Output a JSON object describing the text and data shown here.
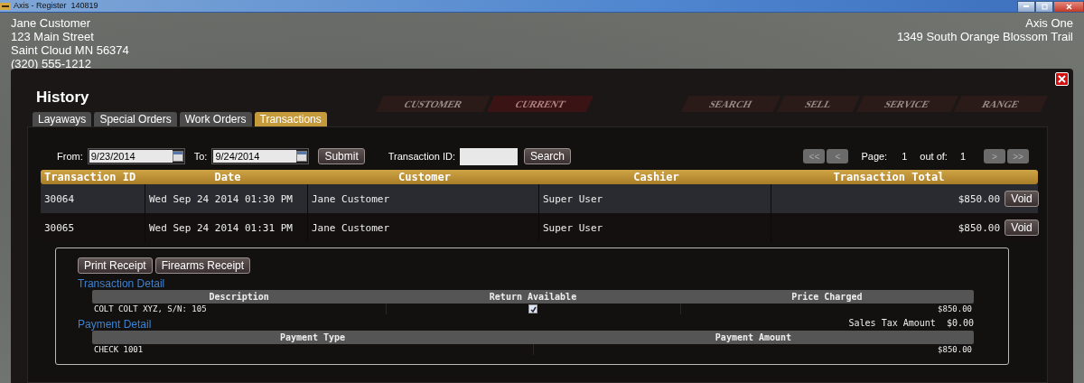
{
  "window": {
    "title": "Axis - Register  140819"
  },
  "customer": {
    "name": "Jane Customer",
    "street": "123 Main Street",
    "city": "Saint Cloud MN 56374",
    "phone": "(320) 555-1212"
  },
  "store": {
    "name": "Axis One",
    "address": "1349 South Orange Blossom Trail"
  },
  "background_nav": [
    {
      "label": "CUSTOMER",
      "selected": false
    },
    {
      "label": "CURRENT",
      "selected": true
    },
    {
      "label": "SEARCH",
      "selected": false
    },
    {
      "label": "SELL",
      "selected": false
    },
    {
      "label": "SERVICE",
      "selected": false
    },
    {
      "label": "RANGE",
      "selected": false
    }
  ],
  "history": {
    "title": "History",
    "tabs": [
      {
        "label": "Layaways",
        "selected": false
      },
      {
        "label": "Special Orders",
        "selected": false
      },
      {
        "label": "Work Orders",
        "selected": false
      },
      {
        "label": "Transactions",
        "selected": true
      }
    ],
    "filters": {
      "from_label": "From:",
      "from_value": "9/23/2014",
      "to_label": "To:",
      "to_value": "9/24/2014",
      "submit": "Submit",
      "transaction_id_label": "Transaction ID:",
      "search": "Search"
    },
    "pager": {
      "first": "<<",
      "prev": "<",
      "page_label": "Page:",
      "page": "1",
      "out_of_label": "out of:",
      "out_of": "1",
      "next": ">",
      "last": ">>",
      "disabled": true
    },
    "table": {
      "columns": [
        "Transaction ID",
        "Date",
        "Customer",
        "Cashier",
        "Transaction Total"
      ],
      "rows": [
        {
          "id": "30064",
          "date": "Wed Sep 24 2014 01:30 PM",
          "customer": "Jane Customer",
          "cashier": "Super User",
          "total": "$850.00",
          "action": "Void",
          "selected": true,
          "expanded": false
        },
        {
          "id": "30065",
          "date": "Wed Sep 24 2014 01:31 PM",
          "customer": "Jane Customer",
          "cashier": "Super User",
          "total": "$850.00",
          "action": "Void",
          "selected": false,
          "expanded": true
        }
      ]
    },
    "detail": {
      "buttons": [
        "Print Receipt",
        "Firearms Receipt"
      ],
      "transaction_detail": {
        "title": "Transaction Detail",
        "columns": [
          "Description",
          "Return Available",
          "Price Charged"
        ],
        "rows": [
          {
            "description": "COLT COLT XYZ, S/N: 105",
            "return_available": true,
            "price": "$850.00"
          }
        ]
      },
      "sales_tax": {
        "label": "Sales Tax Amount",
        "value": "$0.00"
      },
      "payment_detail": {
        "title": "Payment Detail",
        "columns": [
          "Payment Type",
          "Payment Amount"
        ],
        "rows": [
          {
            "type": "CHECK 1001",
            "amount": "$850.00"
          }
        ]
      }
    }
  }
}
